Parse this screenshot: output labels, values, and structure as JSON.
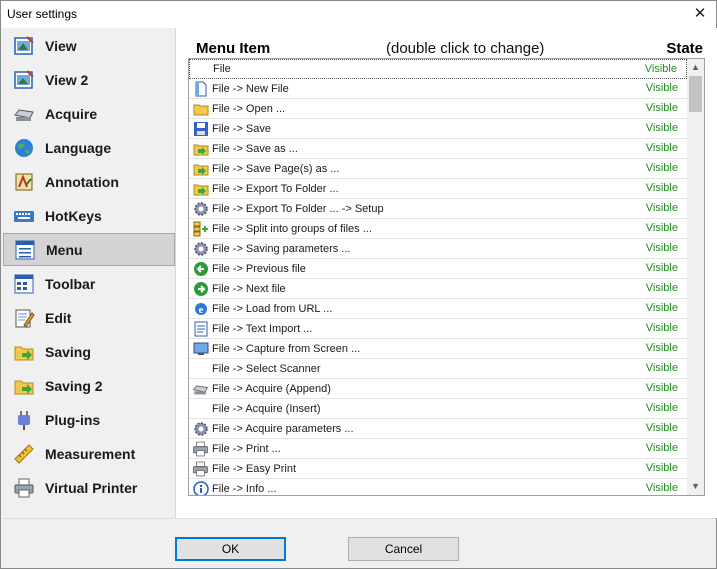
{
  "window": {
    "title": "User settings"
  },
  "sidebar": {
    "items": [
      {
        "label": "View",
        "icon": "view-icon"
      },
      {
        "label": "View 2",
        "icon": "view2-icon"
      },
      {
        "label": "Acquire",
        "icon": "scanner-icon"
      },
      {
        "label": "Language",
        "icon": "globe-icon"
      },
      {
        "label": "Annotation",
        "icon": "annotation-icon"
      },
      {
        "label": "HotKeys",
        "icon": "keyboard-icon"
      },
      {
        "label": "Menu",
        "icon": "menu-icon",
        "active": true
      },
      {
        "label": "Toolbar",
        "icon": "toolbar-icon"
      },
      {
        "label": "Edit",
        "icon": "edit-icon"
      },
      {
        "label": "Saving",
        "icon": "saving-icon"
      },
      {
        "label": "Saving 2",
        "icon": "saving2-icon"
      },
      {
        "label": "Plug-ins",
        "icon": "plugin-icon"
      },
      {
        "label": "Measurement",
        "icon": "ruler-icon"
      },
      {
        "label": "Virtual Printer",
        "icon": "printer-icon"
      }
    ]
  },
  "header": {
    "item": "Menu Item",
    "hint": "(double click to change)",
    "state": "State"
  },
  "list": {
    "rows": [
      {
        "label": "File",
        "state": "Visible",
        "icon": "none"
      },
      {
        "label": "File -> New File",
        "state": "Visible",
        "icon": "new-file-icon"
      },
      {
        "label": "File -> Open ...",
        "state": "Visible",
        "icon": "folder-icon"
      },
      {
        "label": "File -> Save",
        "state": "Visible",
        "icon": "floppy-icon"
      },
      {
        "label": "File -> Save as ...",
        "state": "Visible",
        "icon": "save-as-icon"
      },
      {
        "label": "File -> Save Page(s) as ...",
        "state": "Visible",
        "icon": "save-pages-icon"
      },
      {
        "label": "File -> Export To Folder ...",
        "state": "Visible",
        "icon": "export-icon"
      },
      {
        "label": "File -> Export To Folder ... -> Setup",
        "state": "Visible",
        "icon": "gear-icon"
      },
      {
        "label": "File -> Split into groups of files ...",
        "state": "Visible",
        "icon": "split-icon"
      },
      {
        "label": "File -> Saving parameters ...",
        "state": "Visible",
        "icon": "gear-icon"
      },
      {
        "label": "File -> Previous file",
        "state": "Visible",
        "icon": "arrow-left-icon"
      },
      {
        "label": "File -> Next file",
        "state": "Visible",
        "icon": "arrow-right-icon"
      },
      {
        "label": "File -> Load from URL ...",
        "state": "Visible",
        "icon": "ie-icon"
      },
      {
        "label": "File -> Text Import ...",
        "state": "Visible",
        "icon": "text-doc-icon"
      },
      {
        "label": "File -> Capture from Screen ...",
        "state": "Visible",
        "icon": "monitor-icon"
      },
      {
        "label": "File -> Select Scanner",
        "state": "Visible",
        "icon": "none"
      },
      {
        "label": "File -> Acquire (Append)",
        "state": "Visible",
        "icon": "scanner-icon"
      },
      {
        "label": "File -> Acquire (Insert)",
        "state": "Visible",
        "icon": "none"
      },
      {
        "label": "File -> Acquire parameters ...",
        "state": "Visible",
        "icon": "gear-icon"
      },
      {
        "label": "File -> Print ...",
        "state": "Visible",
        "icon": "printer-icon"
      },
      {
        "label": "File -> Easy Print",
        "state": "Visible",
        "icon": "printer-icon"
      },
      {
        "label": "File -> Info ...",
        "state": "Visible",
        "icon": "info-icon"
      }
    ]
  },
  "footer": {
    "ok_label": "OK",
    "cancel_label": "Cancel"
  },
  "colors": {
    "state_visible": "#1e8c1e",
    "ok_border": "#0078d7",
    "active_item_bg": "#d4d4d4"
  }
}
